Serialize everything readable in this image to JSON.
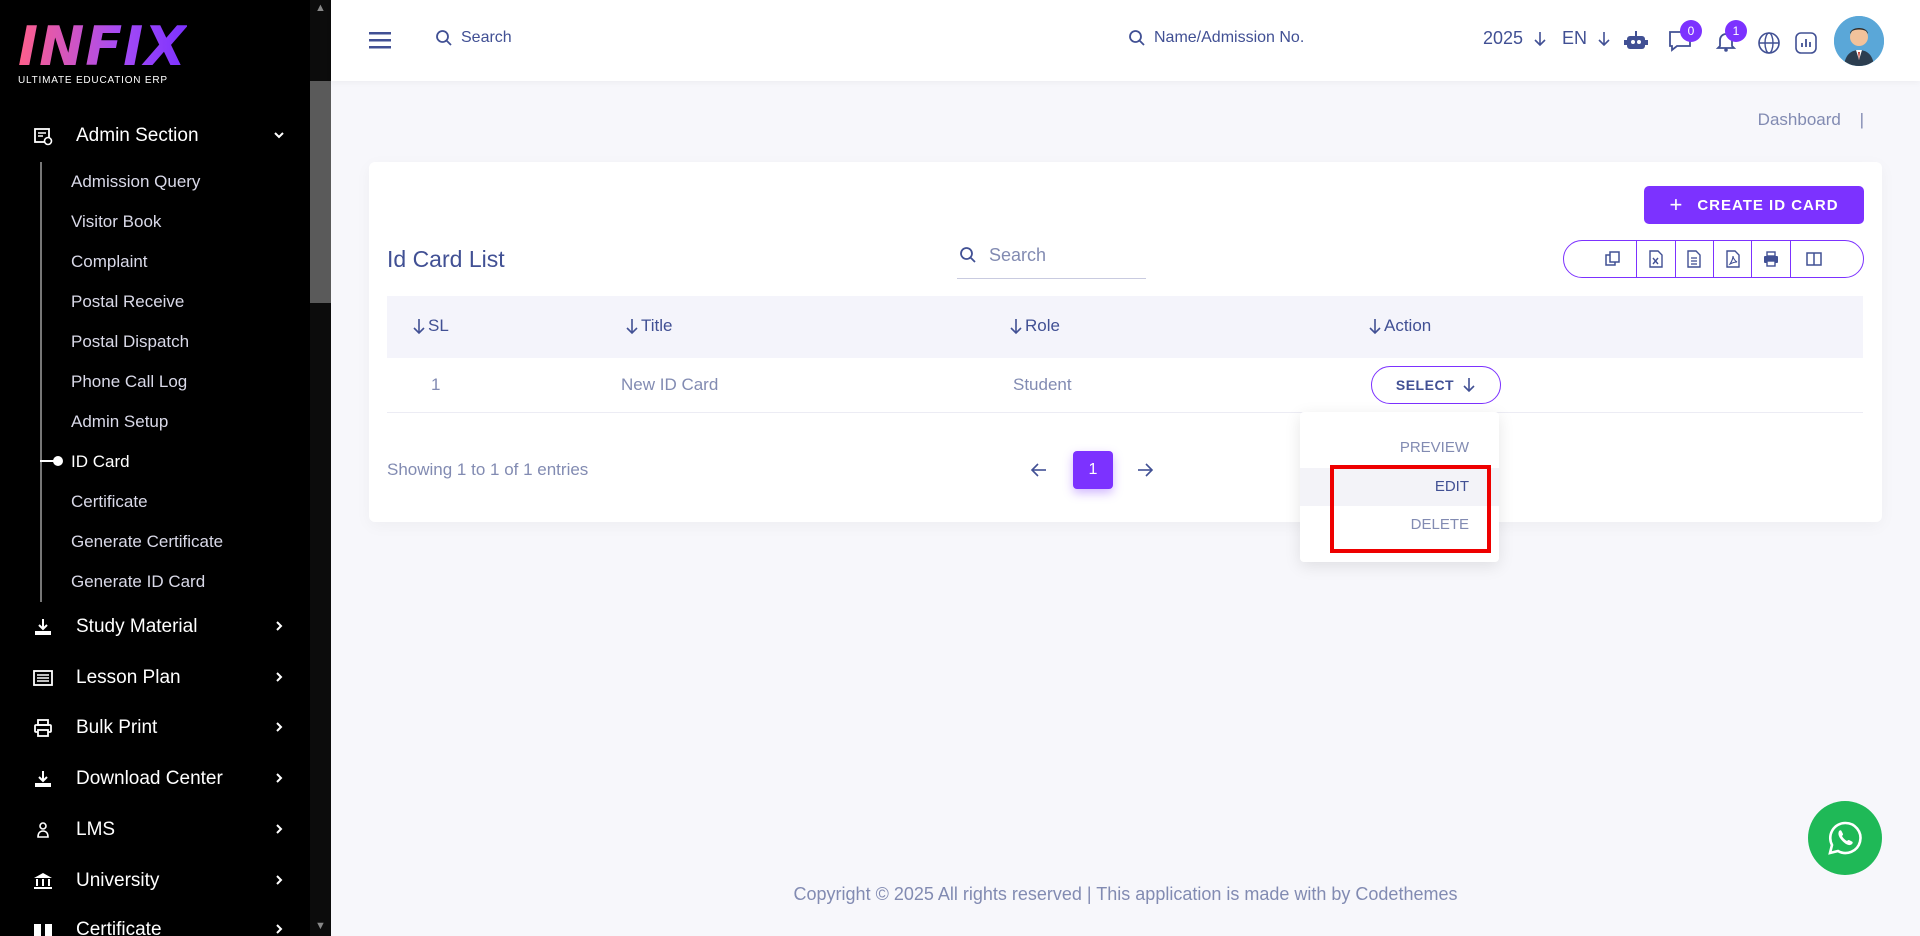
{
  "brand": {
    "name": "INFIX",
    "tagline": "ULTIMATE EDUCATION ERP"
  },
  "sidebar": {
    "sections": [
      {
        "label": "Admin Section",
        "icon": "admin-icon",
        "expanded": true
      },
      {
        "label": "Study Material",
        "icon": "download-icon"
      },
      {
        "label": "Lesson Plan",
        "icon": "list-icon"
      },
      {
        "label": "Bulk Print",
        "icon": "printer-icon"
      },
      {
        "label": "Download Center",
        "icon": "download-icon"
      },
      {
        "label": "LMS",
        "icon": "lms-icon"
      },
      {
        "label": "University",
        "icon": "university-icon"
      },
      {
        "label": "Certificate",
        "icon": "book-icon"
      }
    ],
    "admin_items": [
      {
        "label": "Admission Query"
      },
      {
        "label": "Visitor Book"
      },
      {
        "label": "Complaint"
      },
      {
        "label": "Postal Receive"
      },
      {
        "label": "Postal Dispatch"
      },
      {
        "label": "Phone Call Log"
      },
      {
        "label": "Admin Setup"
      },
      {
        "label": "ID Card",
        "active": true
      },
      {
        "label": "Certificate"
      },
      {
        "label": "Generate Certificate"
      },
      {
        "label": "Generate ID Card"
      }
    ]
  },
  "header": {
    "search_label": "Search",
    "student_search_label": "Name/Admission No.",
    "year": "2025",
    "language": "EN",
    "messages_count": "0",
    "notifications_count": "1"
  },
  "breadcrumb": {
    "items": [
      "Dashboard",
      "|"
    ]
  },
  "idcards": {
    "create_label": "CREATE ID CARD",
    "title": "Id Card List",
    "search_placeholder": "Search",
    "columns": [
      "SL",
      "Title",
      "Role",
      "Action"
    ],
    "rows": [
      {
        "sl": "1",
        "title": "New ID Card",
        "role": "Student",
        "action": "SELECT"
      }
    ],
    "dropdown": [
      "PREVIEW",
      "EDIT",
      "DELETE"
    ],
    "showing": "Showing 1 to 1 of 1 entries",
    "current_page": "1"
  },
  "footer": {
    "text": "Copyright © 2025 All rights reserved | This application is made with by Codethemes"
  },
  "colors": {
    "accent": "#7c32ff",
    "text": "#415094",
    "muted": "#828bb2",
    "sidebar": "#000000",
    "whatsapp": "#1fb957",
    "highlight": "#ee0000"
  }
}
